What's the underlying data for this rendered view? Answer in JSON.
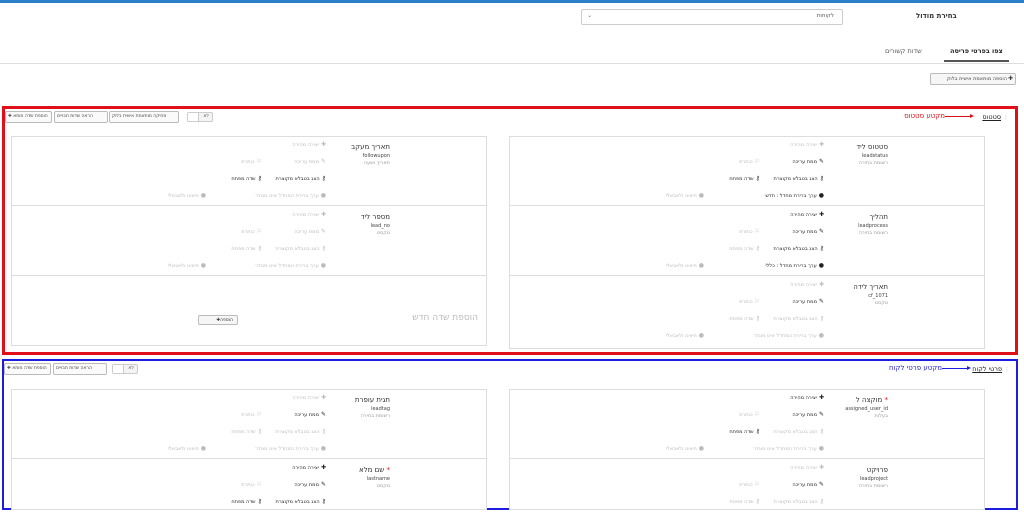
{
  "header": {
    "module_label": "בחירת מודול",
    "module_value": "לקוחות",
    "chevron_icon": "chevron-down-icon"
  },
  "tabs": [
    {
      "label": "צפו בפרטי פריסה",
      "active": true
    },
    {
      "label": "שדות קשורים",
      "active": false
    }
  ],
  "toolbar": {
    "add_block_label": "הוספה מותאמת אישית בלוק"
  },
  "blocks": [
    {
      "title": "סטטוס",
      "annotation": "מקטע סטטוס",
      "annotation_color": "#e0101a",
      "controls": {
        "add_field": "הוספת שדה מותא",
        "show_hidden": "הראה שדות חבויים",
        "inactive": "מחיקה מותאמת אישית בלוק",
        "toggle": "לא"
      },
      "right_fields": [
        {
          "name": "סטטוס ליד",
          "key": "leadstatus",
          "type": "רשומת בחירה",
          "quick_create": "יצירה מהירה",
          "mass_edit": "ממת עריכה",
          "header": "כותרת",
          "summary": "הצג בטבלא מקוצרת",
          "key_field": "שדה מפתח",
          "default_value": "ערך ברירת מחדל : חדש",
          "mandatory": "חיוויגו ולאבאלי",
          "active": {
            "quick_create": false,
            "mass_edit": true,
            "header": false,
            "summary": true,
            "key_field": true,
            "default_value": true
          }
        },
        {
          "name": "תהליך",
          "key": "leadprocess",
          "type": "רשומת בחירה",
          "quick_create": "יצירה מהירה",
          "mass_edit": "ממת עריכה",
          "header": "כותרת",
          "summary": "הצג בטבלא מקוצרת",
          "key_field": "שדה מפתח",
          "default_value": "ערך ברירת מחדל : כללי",
          "mandatory": "חיוויגו ולאבאלי",
          "active": {
            "quick_create": true,
            "mass_edit": true,
            "header": false,
            "summary": true,
            "key_field": false,
            "default_value": true
          }
        },
        {
          "name": "תאריך לידה",
          "key": "cf_1071",
          "type": "טקסט",
          "quick_create": "יצירה מהירה",
          "mass_edit": "ממת עריכה",
          "header": "כותרת",
          "summary": "הצג בטבלא מקוצרת",
          "key_field": "שדה מפתח",
          "default_value": "ערך ברירת המחדל אינו מוגדר",
          "mandatory": "חיוויגו ולאבאלי",
          "active": {
            "quick_create": false,
            "mass_edit": true,
            "header": false,
            "summary": false,
            "key_field": false,
            "default_value": false
          }
        }
      ],
      "left_fields": [
        {
          "name": "תאריך מעקב",
          "key": "followupon",
          "type": "תאריך ושעה",
          "quick_create": "יצירה מהירה",
          "mass_edit": "ממת עריכה",
          "header": "כותרת",
          "summary": "הצג בטבלא מקוצרת",
          "key_field": "שדה מפתח",
          "default_value": "ערך ברירת המחדל אינו מוגדר",
          "mandatory": "חיוויגו ולאבאלי",
          "active": {
            "quick_create": false,
            "mass_edit": false,
            "header": false,
            "summary": true,
            "key_field": true,
            "default_value": false
          }
        },
        {
          "name": "מספר ליד",
          "key": "lead_no",
          "type": "טקסט",
          "quick_create": "יצירה מהירה",
          "mass_edit": "ממת עריכה",
          "header": "כותרת",
          "summary": "הצג בטבלא מקוצרת",
          "key_field": "שדה מפתח",
          "default_value": "ערך ברירת המחדל אינו מוגדר",
          "mandatory": "חיוויגו ולאבאלי",
          "active": {
            "quick_create": false,
            "mass_edit": false,
            "header": false,
            "summary": false,
            "key_field": false,
            "default_value": false
          }
        }
      ],
      "add_field_title": "הוספת שדה חדש",
      "add_button": "הוספה"
    },
    {
      "title": "פרטי לקוח",
      "annotation": "מקטע פרטי לקוח",
      "annotation_color": "#1d1de0",
      "controls": {
        "add_field": "הוספת שדה מותא",
        "show_hidden": "הראה שדות חבויים",
        "toggle": "לא"
      },
      "right_fields": [
        {
          "name": "מוקצה ל",
          "required": true,
          "key": "assigned_user_id",
          "type": "בעלות",
          "quick_create": "יצירה מהירה",
          "mass_edit": "ממת עריכה",
          "header": "כותרת",
          "summary": "הצג בטבלא מקוצרת",
          "key_field": "שדה מפתח",
          "default_value": "ערך ברירת המחדל אינו מוגדר",
          "mandatory": "חיוויגו ולאבאלי",
          "active": {
            "quick_create": true,
            "mass_edit": true,
            "header": false,
            "summary": false,
            "key_field": true,
            "default_value": false
          }
        },
        {
          "name": "פרויקט",
          "key": "leadproject",
          "type": "רשומת בחירה",
          "quick_create": "יצירה מהירה",
          "mass_edit": "ממת עריכה",
          "header": "כותרת",
          "summary": "הצג בטבלא מקוצרת",
          "key_field": "שדה מפתח",
          "active": {
            "quick_create": false,
            "mass_edit": true,
            "header": false,
            "summary": false,
            "key_field": false
          }
        }
      ],
      "left_fields": [
        {
          "name": "תגית עופרת",
          "key": "leadtag",
          "type": "רשומת בחירה",
          "quick_create": "יצירה מהירה",
          "mass_edit": "ממת עריכה",
          "header": "כותרת",
          "summary": "הצג בטבלא מקוצרת",
          "key_field": "שדה מפתח",
          "default_value": "ערך ברירת המחדל אינו מוגדר",
          "mandatory": "חיוויגו ולאבאלי",
          "active": {
            "quick_create": false,
            "mass_edit": true,
            "header": false,
            "summary": false,
            "key_field": false,
            "default_value": false
          }
        },
        {
          "name": "שם מלא",
          "required": true,
          "key": "lastname",
          "type": "טקסט",
          "quick_create": "יצירה מהירה",
          "mass_edit": "ממת עריכה",
          "header": "כותרת",
          "summary": "הצג בטבלא מקוצרת",
          "key_field": "שדה מפתח",
          "active": {
            "quick_create": true,
            "mass_edit": true,
            "header": false,
            "summary": true,
            "key_field": true
          }
        }
      ]
    }
  ]
}
